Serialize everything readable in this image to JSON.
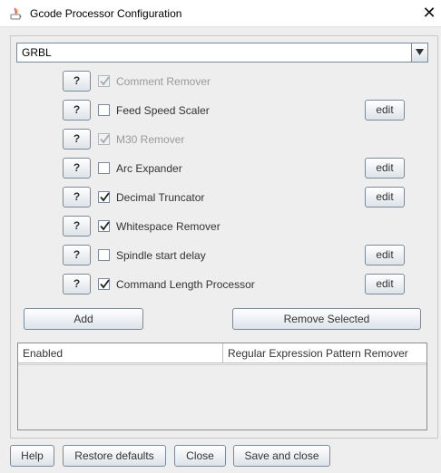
{
  "window": {
    "title": "Gcode Processor Configuration",
    "close_glyph": "✕",
    "icon": "java-app-icon"
  },
  "firmware_select": {
    "value": "GRBL",
    "arrow": "▼"
  },
  "processors": [
    {
      "help": "?",
      "label": "Comment Remover",
      "checked": true,
      "enabled": false,
      "edit": ""
    },
    {
      "help": "?",
      "label": "Feed Speed Scaler",
      "checked": false,
      "enabled": true,
      "edit": "edit"
    },
    {
      "help": "?",
      "label": "M30 Remover",
      "checked": true,
      "enabled": false,
      "edit": ""
    },
    {
      "help": "?",
      "label": "Arc Expander",
      "checked": false,
      "enabled": true,
      "edit": "edit"
    },
    {
      "help": "?",
      "label": "Decimal Truncator",
      "checked": true,
      "enabled": true,
      "edit": "edit"
    },
    {
      "help": "?",
      "label": "Whitespace Remover",
      "checked": true,
      "enabled": true,
      "edit": ""
    },
    {
      "help": "?",
      "label": "Spindle start delay",
      "checked": false,
      "enabled": true,
      "edit": "edit"
    },
    {
      "help": "?",
      "label": "Command Length Processor",
      "checked": true,
      "enabled": true,
      "edit": "edit"
    }
  ],
  "actions": {
    "add": "Add",
    "remove_selected": "Remove Selected"
  },
  "table": {
    "columns": [
      "Enabled",
      "Regular Expression Pattern Remover"
    ],
    "rows": []
  },
  "footer": {
    "help": "Help",
    "restore_defaults": "Restore defaults",
    "close": "Close",
    "save_and_close": "Save and close"
  }
}
